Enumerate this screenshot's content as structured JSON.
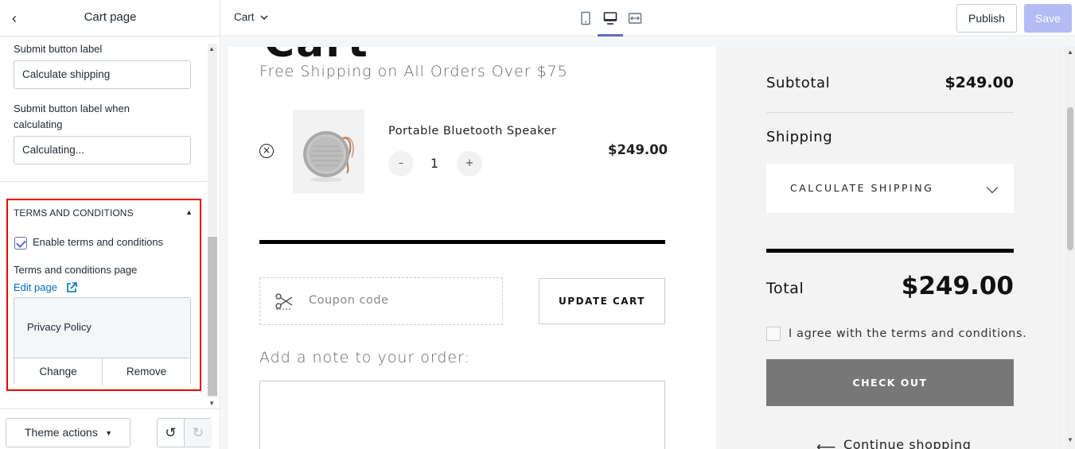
{
  "sidebar": {
    "title": "Cart page",
    "fields": [
      {
        "label": "Submit button label",
        "value": "Calculate shipping"
      },
      {
        "label": "Submit button label when calculating",
        "value": "Calculating..."
      }
    ],
    "terms_section": {
      "title": "TERMS AND CONDITIONS",
      "enable_label": "Enable terms and conditions",
      "enabled": true,
      "page_label": "Terms and conditions page",
      "edit_link": "Edit page",
      "selected_page": "Privacy Policy",
      "change_label": "Change",
      "remove_label": "Remove"
    },
    "footer": {
      "theme_actions": "Theme actions"
    }
  },
  "topbar": {
    "page_select": "Cart",
    "active_device": "desktop",
    "publish_label": "Publish",
    "save_label": "Save"
  },
  "preview": {
    "page_title": "Cart",
    "free_shipping": "Free Shipping on All Orders Over $75",
    "item": {
      "name": "Portable Bluetooth Speaker",
      "quantity": "1",
      "price": "$249.00",
      "minus": "–",
      "plus": "+"
    },
    "coupon_placeholder": "Coupon code",
    "update_cart": "UPDATE CART",
    "note_label": "Add a note to your order:",
    "summary": {
      "subtotal_label": "Subtotal",
      "subtotal_value": "$249.00",
      "shipping_label": "Shipping",
      "calculate_shipping": "CALCULATE SHIPPING",
      "total_label": "Total",
      "total_value": "$249.00",
      "agree_text": "I agree with the terms and conditions.",
      "checkout": "CHECK OUT",
      "continue_shopping": "Continue shopping"
    }
  },
  "colors": {
    "accent": "#5c6ac4",
    "save_disabled": "#b3bcf5",
    "highlight_border": "#ee0000",
    "link": "#006fbb",
    "checkout_bg": "#777777"
  }
}
